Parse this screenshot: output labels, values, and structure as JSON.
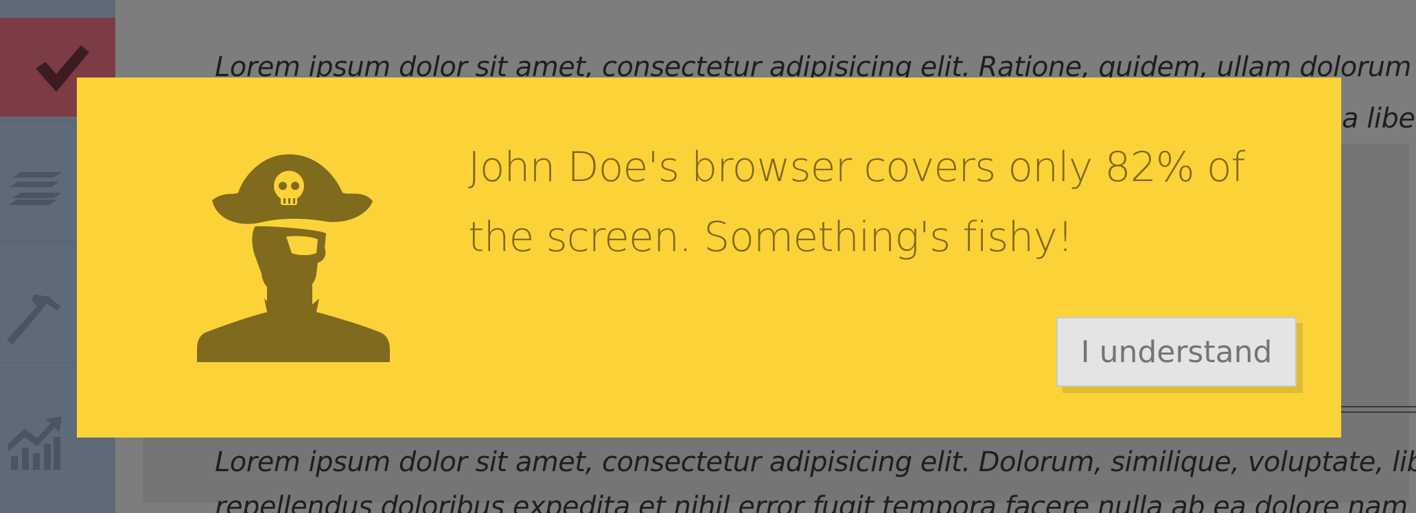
{
  "sidebar": {
    "items": [
      {
        "icon": "checkmark-icon",
        "active": true
      },
      {
        "icon": "layers-icon"
      },
      {
        "icon": "hammer-icon"
      },
      {
        "icon": "chart-growth-icon"
      }
    ]
  },
  "content": {
    "paragraph1_line1": "Lorem ipsum dolor sit amet, consectetur adipisicing elit. Ratione, quidem, ullam dolorum e",
    "paragraph1_line2_fragment": "a libe",
    "paragraph2_line1": "Lorem ipsum dolor sit amet, consectetur adipisicing elit. Dolorum, similique, voluptate, libe",
    "paragraph2_line2": "repellendus doloribus expedita et nihil error fugit tempora facere nulla ab ea dolore nam"
  },
  "modal": {
    "icon": "pirate-icon",
    "message": "John Doe's browser covers only 82% of the screen. Something's fishy!",
    "button_label": "I understand"
  },
  "colors": {
    "modal_bg": "#fbd338",
    "modal_text": "#806a1d",
    "sidebar": "#5e6a77",
    "sidebar_active": "#7c3c45"
  }
}
